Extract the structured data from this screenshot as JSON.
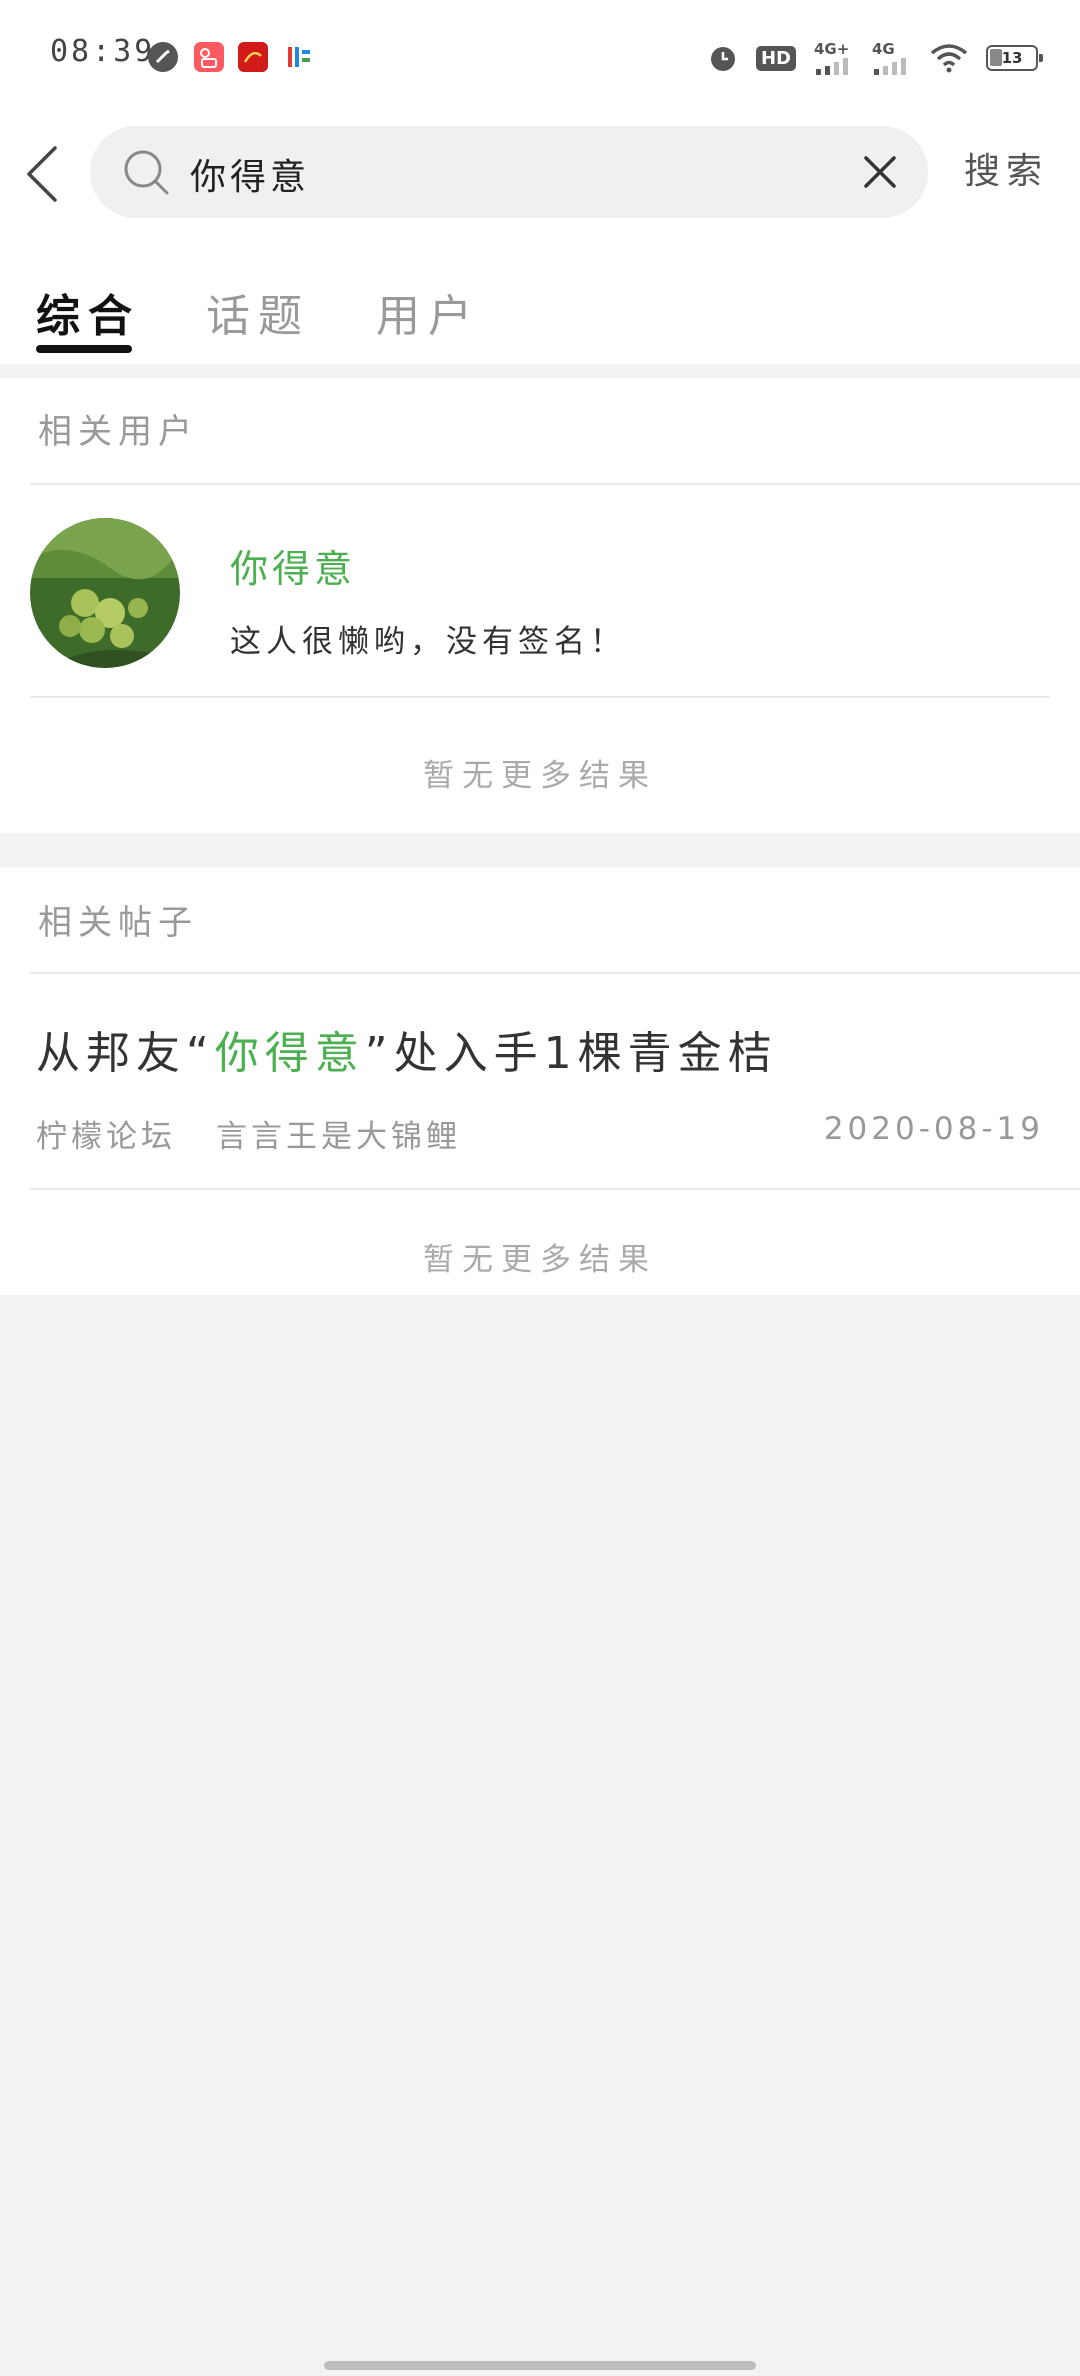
{
  "status_bar": {
    "time": "08:39",
    "battery": "13",
    "hd_label": "HD",
    "net1": "4G+",
    "net2": "4G",
    "app_icons": [
      "browser-icon",
      "kuaishou-icon",
      "xuexi-icon",
      "app-icon"
    ]
  },
  "search": {
    "query": "你得意",
    "button_label": "搜索"
  },
  "tabs": [
    {
      "label": "综合",
      "active": true
    },
    {
      "label": "话题",
      "active": false
    },
    {
      "label": "用户",
      "active": false
    }
  ],
  "related_users": {
    "section_title": "相关用户",
    "user": {
      "name": "你得意",
      "signature": "这人很懒哟，没有签名！"
    },
    "no_more": "暂无更多结果"
  },
  "related_posts": {
    "section_title": "相关帖子",
    "post": {
      "title_prefix": "从邦友",
      "title_open_quote": "“",
      "title_highlight": "你得意",
      "title_close_quote": "”",
      "title_suffix": "处入手1棵青金桔",
      "forum": "柠檬论坛",
      "author": "言言王是大锦鲤",
      "date": "2020-08-19"
    },
    "no_more": "暂无更多结果"
  },
  "colors": {
    "accent_green": "#4caf50",
    "background": "#f2f2f2"
  }
}
